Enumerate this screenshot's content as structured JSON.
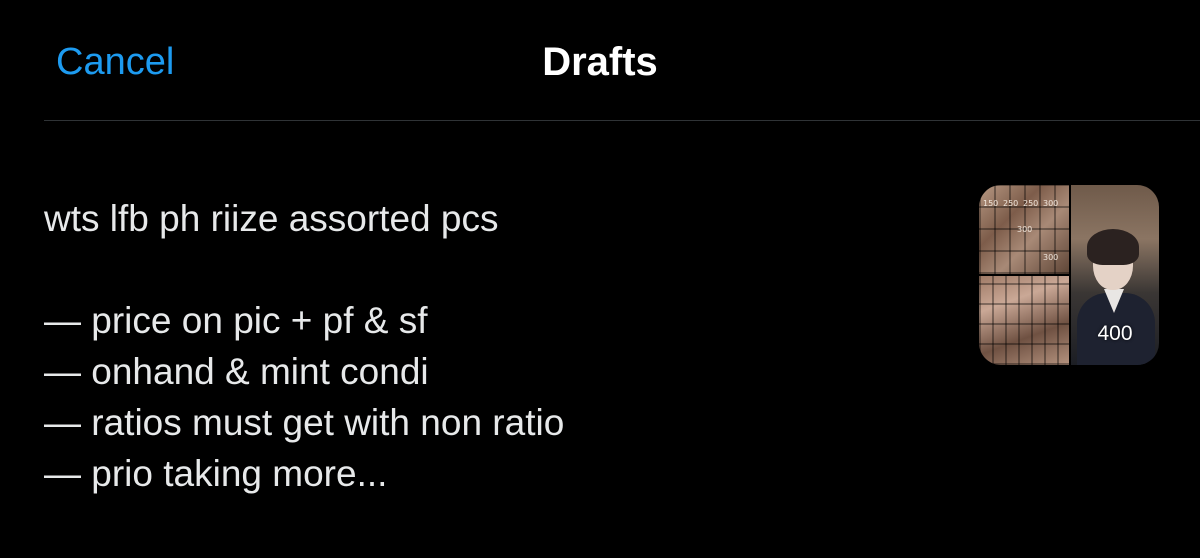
{
  "header": {
    "cancel_label": "Cancel",
    "title": "Drafts"
  },
  "draft": {
    "lines": [
      "wts lfb ph riize assorted pcs",
      "",
      "— price on pic + pf & sf",
      "— onhand & mint condi",
      "— ratios must get with non ratio",
      "— prio taking more..."
    ],
    "thumbnail": {
      "overlay_label": "400",
      "mini_prices_top": [
        "150",
        "250",
        "250",
        "300"
      ],
      "mini_prices_mid": [
        "300"
      ],
      "mini_prices_bottom": [
        "300"
      ]
    }
  },
  "colors": {
    "background": "#000000",
    "accent": "#1d9bf0",
    "text": "#e7e9ea",
    "divider": "#2f3336"
  }
}
